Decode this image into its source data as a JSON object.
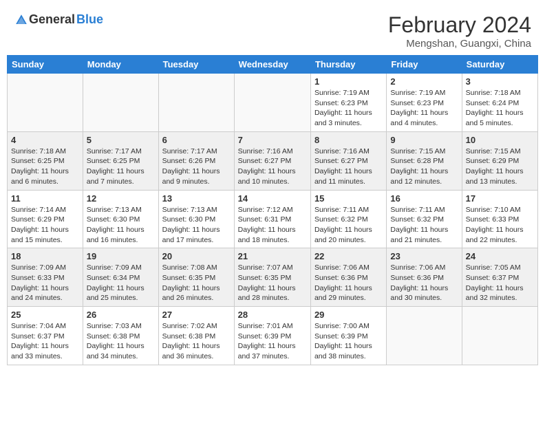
{
  "logo": {
    "general": "General",
    "blue": "Blue"
  },
  "title": {
    "month_year": "February 2024",
    "location": "Mengshan, Guangxi, China"
  },
  "headers": [
    "Sunday",
    "Monday",
    "Tuesday",
    "Wednesday",
    "Thursday",
    "Friday",
    "Saturday"
  ],
  "weeks": [
    {
      "shaded": false,
      "days": [
        {
          "num": "",
          "info": ""
        },
        {
          "num": "",
          "info": ""
        },
        {
          "num": "",
          "info": ""
        },
        {
          "num": "",
          "info": ""
        },
        {
          "num": "1",
          "info": "Sunrise: 7:19 AM\nSunset: 6:23 PM\nDaylight: 11 hours and 3 minutes."
        },
        {
          "num": "2",
          "info": "Sunrise: 7:19 AM\nSunset: 6:23 PM\nDaylight: 11 hours and 4 minutes."
        },
        {
          "num": "3",
          "info": "Sunrise: 7:18 AM\nSunset: 6:24 PM\nDaylight: 11 hours and 5 minutes."
        }
      ]
    },
    {
      "shaded": true,
      "days": [
        {
          "num": "4",
          "info": "Sunrise: 7:18 AM\nSunset: 6:25 PM\nDaylight: 11 hours and 6 minutes."
        },
        {
          "num": "5",
          "info": "Sunrise: 7:17 AM\nSunset: 6:25 PM\nDaylight: 11 hours and 7 minutes."
        },
        {
          "num": "6",
          "info": "Sunrise: 7:17 AM\nSunset: 6:26 PM\nDaylight: 11 hours and 9 minutes."
        },
        {
          "num": "7",
          "info": "Sunrise: 7:16 AM\nSunset: 6:27 PM\nDaylight: 11 hours and 10 minutes."
        },
        {
          "num": "8",
          "info": "Sunrise: 7:16 AM\nSunset: 6:27 PM\nDaylight: 11 hours and 11 minutes."
        },
        {
          "num": "9",
          "info": "Sunrise: 7:15 AM\nSunset: 6:28 PM\nDaylight: 11 hours and 12 minutes."
        },
        {
          "num": "10",
          "info": "Sunrise: 7:15 AM\nSunset: 6:29 PM\nDaylight: 11 hours and 13 minutes."
        }
      ]
    },
    {
      "shaded": false,
      "days": [
        {
          "num": "11",
          "info": "Sunrise: 7:14 AM\nSunset: 6:29 PM\nDaylight: 11 hours and 15 minutes."
        },
        {
          "num": "12",
          "info": "Sunrise: 7:13 AM\nSunset: 6:30 PM\nDaylight: 11 hours and 16 minutes."
        },
        {
          "num": "13",
          "info": "Sunrise: 7:13 AM\nSunset: 6:30 PM\nDaylight: 11 hours and 17 minutes."
        },
        {
          "num": "14",
          "info": "Sunrise: 7:12 AM\nSunset: 6:31 PM\nDaylight: 11 hours and 18 minutes."
        },
        {
          "num": "15",
          "info": "Sunrise: 7:11 AM\nSunset: 6:32 PM\nDaylight: 11 hours and 20 minutes."
        },
        {
          "num": "16",
          "info": "Sunrise: 7:11 AM\nSunset: 6:32 PM\nDaylight: 11 hours and 21 minutes."
        },
        {
          "num": "17",
          "info": "Sunrise: 7:10 AM\nSunset: 6:33 PM\nDaylight: 11 hours and 22 minutes."
        }
      ]
    },
    {
      "shaded": true,
      "days": [
        {
          "num": "18",
          "info": "Sunrise: 7:09 AM\nSunset: 6:33 PM\nDaylight: 11 hours and 24 minutes."
        },
        {
          "num": "19",
          "info": "Sunrise: 7:09 AM\nSunset: 6:34 PM\nDaylight: 11 hours and 25 minutes."
        },
        {
          "num": "20",
          "info": "Sunrise: 7:08 AM\nSunset: 6:35 PM\nDaylight: 11 hours and 26 minutes."
        },
        {
          "num": "21",
          "info": "Sunrise: 7:07 AM\nSunset: 6:35 PM\nDaylight: 11 hours and 28 minutes."
        },
        {
          "num": "22",
          "info": "Sunrise: 7:06 AM\nSunset: 6:36 PM\nDaylight: 11 hours and 29 minutes."
        },
        {
          "num": "23",
          "info": "Sunrise: 7:06 AM\nSunset: 6:36 PM\nDaylight: 11 hours and 30 minutes."
        },
        {
          "num": "24",
          "info": "Sunrise: 7:05 AM\nSunset: 6:37 PM\nDaylight: 11 hours and 32 minutes."
        }
      ]
    },
    {
      "shaded": false,
      "days": [
        {
          "num": "25",
          "info": "Sunrise: 7:04 AM\nSunset: 6:37 PM\nDaylight: 11 hours and 33 minutes."
        },
        {
          "num": "26",
          "info": "Sunrise: 7:03 AM\nSunset: 6:38 PM\nDaylight: 11 hours and 34 minutes."
        },
        {
          "num": "27",
          "info": "Sunrise: 7:02 AM\nSunset: 6:38 PM\nDaylight: 11 hours and 36 minutes."
        },
        {
          "num": "28",
          "info": "Sunrise: 7:01 AM\nSunset: 6:39 PM\nDaylight: 11 hours and 37 minutes."
        },
        {
          "num": "29",
          "info": "Sunrise: 7:00 AM\nSunset: 6:39 PM\nDaylight: 11 hours and 38 minutes."
        },
        {
          "num": "",
          "info": ""
        },
        {
          "num": "",
          "info": ""
        }
      ]
    }
  ]
}
